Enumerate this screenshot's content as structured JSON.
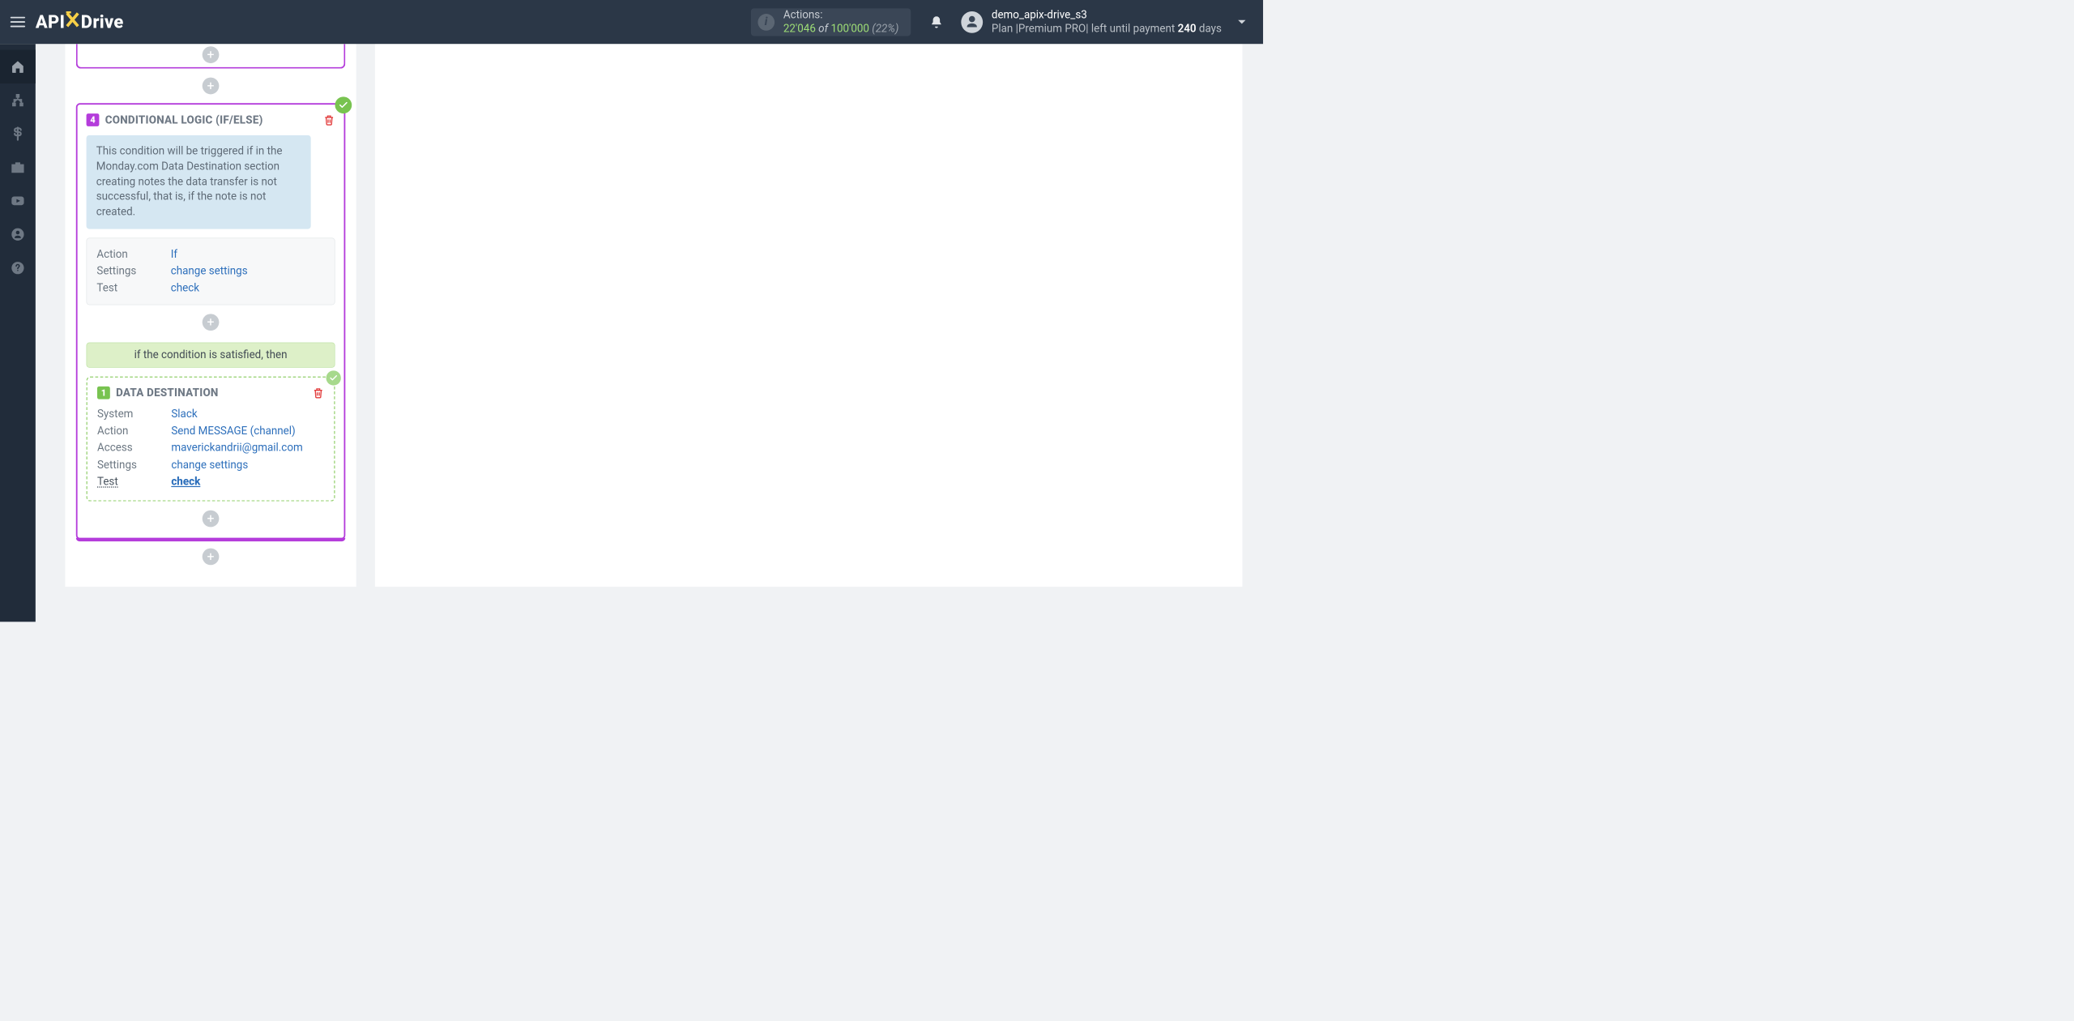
{
  "header": {
    "logo_api": "API",
    "logo_drive": "Drive",
    "actions": {
      "label": "Actions:",
      "used": "22'046",
      "of": "of",
      "total": "100'000",
      "percent": "(22%)"
    },
    "user": {
      "name": "demo_apix-drive_s3",
      "plan_line_prefix": "Plan |Premium PRO| left until payment ",
      "days_num": "240",
      "days_word": " days"
    }
  },
  "sidebar": {
    "items": [
      {
        "id": "home",
        "icon": "home"
      },
      {
        "id": "sitemap",
        "icon": "sitemap"
      },
      {
        "id": "billing",
        "icon": "dollar"
      },
      {
        "id": "briefcase",
        "icon": "brief"
      },
      {
        "id": "video",
        "icon": "video"
      },
      {
        "id": "account",
        "icon": "user"
      },
      {
        "id": "help",
        "icon": "help"
      }
    ]
  },
  "cond_card": {
    "step": "4",
    "title": "CONDITIONAL LOGIC (IF/ELSE)",
    "description": "This condition will be triggered if in the Monday.com Data Destination section creating notes the data transfer is not successful, that is, if the note is not created.",
    "rows": {
      "action_k": "Action",
      "action_v": "If",
      "settings_k": "Settings",
      "settings_v": "change settings",
      "test_k": "Test",
      "test_v": "check"
    },
    "satisfied_text": "if the condition is satisfied, then"
  },
  "inner_card": {
    "step": "1",
    "title": "DATA DESTINATION",
    "rows": {
      "system_k": "System",
      "system_v": "Slack",
      "action_k": "Action",
      "action_v": "Send MESSAGE (channel)",
      "access_k": "Access",
      "access_v": "maverickandrii@gmail.com",
      "settings_k": "Settings",
      "settings_v": "change settings",
      "test_k": "Test",
      "test_v": "check"
    }
  },
  "plus_label": "+"
}
